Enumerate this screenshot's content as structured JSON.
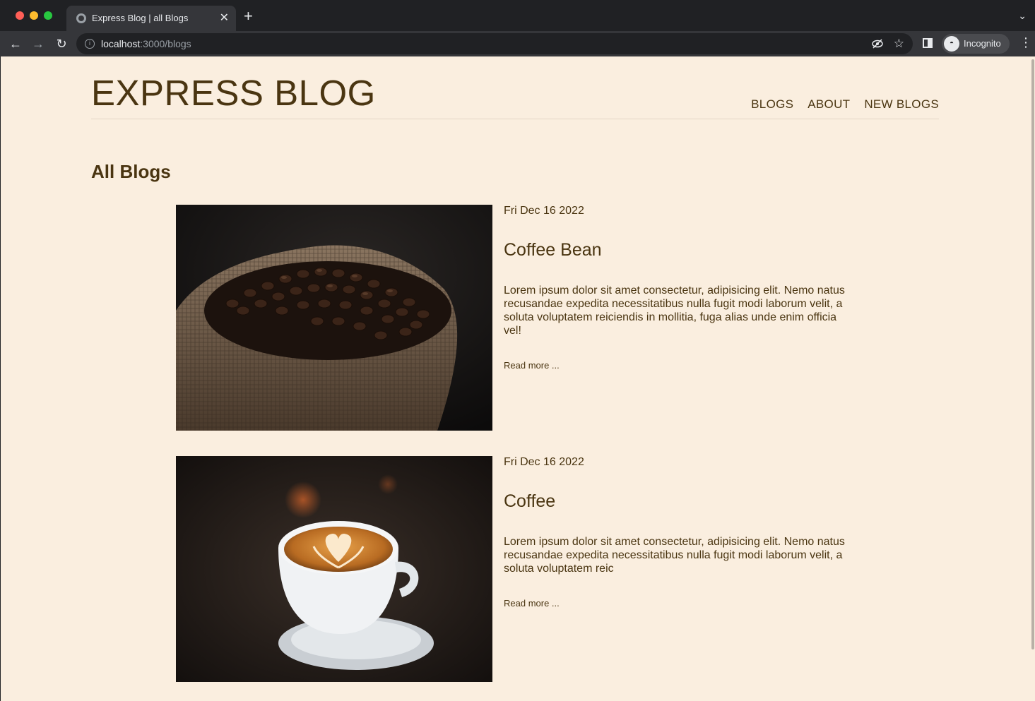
{
  "browser": {
    "tab_title": "Express Blog | all Blogs",
    "url_host": "localhost",
    "url_path": ":3000/blogs",
    "profile_label": "Incognito"
  },
  "site": {
    "title": "EXPRESS BLOG",
    "nav": [
      "BLOGS",
      "ABOUT",
      "NEW BLOGS"
    ]
  },
  "page": {
    "heading": "All Blogs"
  },
  "posts": [
    {
      "date": "Fri Dec 16 2022",
      "title": "Coffee Bean",
      "excerpt": "Lorem ipsum dolor sit amet consectetur, adipisicing elit. Nemo natus recusandae expedita necessitatibus nulla fugit modi laborum velit, a soluta voluptatem reiciendis in mollitia, fuga alias unde enim officia vel!",
      "read_more": "Read more ...",
      "image": "coffee-beans-in-burlap-sack"
    },
    {
      "date": "Fri Dec 16 2022",
      "title": "Coffee",
      "excerpt": "Lorem ipsum dolor sit amet consectetur, adipisicing elit. Nemo natus recusandae expedita necessitatibus nulla fugit modi laborum velit, a soluta voluptatem reic",
      "read_more": "Read more ...",
      "image": "latte-art-cup"
    }
  ],
  "colors": {
    "page_bg": "#faeedf",
    "text_brown": "#4a3511"
  }
}
